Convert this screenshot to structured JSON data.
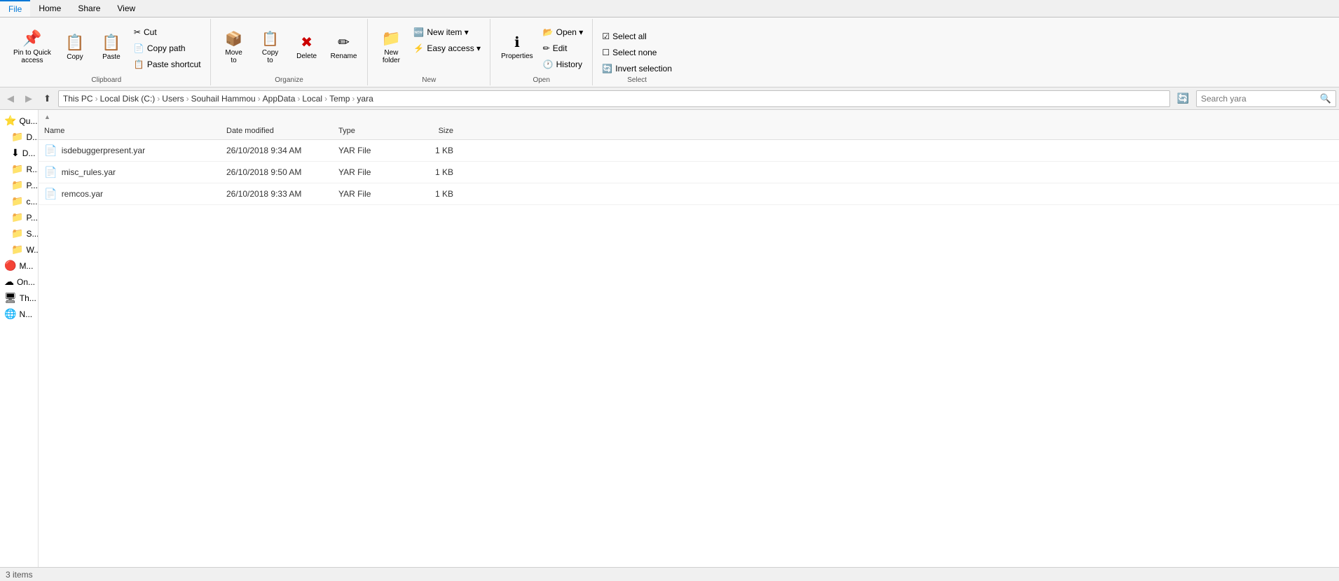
{
  "window": {
    "title": "yara"
  },
  "ribbon": {
    "tabs": [
      {
        "label": "File",
        "active": true
      },
      {
        "label": "Home",
        "active": false
      },
      {
        "label": "Share",
        "active": false
      },
      {
        "label": "View",
        "active": false
      }
    ],
    "clipboard_group": {
      "label": "Clipboard",
      "pin_to_quick": "Pin to Quick\naccess",
      "copy": "Copy",
      "paste": "Paste",
      "cut": "Cut",
      "copy_path": "Copy path",
      "paste_shortcut": "Paste shortcut"
    },
    "organize_group": {
      "label": "Organize",
      "move_to": "Move\nto",
      "copy_to": "Copy\nto",
      "delete": "Delete",
      "rename": "Rename"
    },
    "new_group": {
      "label": "New",
      "new_folder": "New\nfolder",
      "new_item": "New item ▾",
      "easy_access": "Easy access ▾"
    },
    "open_group": {
      "label": "Open",
      "properties": "Properties",
      "open": "Open ▾",
      "edit": "Edit",
      "history": "History"
    },
    "select_group": {
      "label": "Select",
      "select_all": "Select all",
      "select_none": "Select none",
      "invert_selection": "Invert selection"
    }
  },
  "nav": {
    "back": "◀",
    "forward": "▶",
    "up": "⬆",
    "breadcrumbs": [
      {
        "label": "This PC",
        "sep": true
      },
      {
        "label": "Local Disk (C:)",
        "sep": true
      },
      {
        "label": "Users",
        "sep": true
      },
      {
        "label": "Souhail Hammou",
        "sep": true
      },
      {
        "label": "AppData",
        "sep": true
      },
      {
        "label": "Local",
        "sep": true
      },
      {
        "label": "Temp",
        "sep": true
      },
      {
        "label": "yara",
        "sep": false
      }
    ],
    "search_placeholder": "Search yara"
  },
  "sidebar": {
    "items": [
      {
        "label": "Qu...",
        "icon": "⭐"
      },
      {
        "label": "D...",
        "icon": "📁"
      },
      {
        "label": "D...",
        "icon": "⬇"
      },
      {
        "label": "R...",
        "icon": "📁"
      },
      {
        "label": "P...",
        "icon": "📁"
      },
      {
        "label": "c...",
        "icon": "📁"
      },
      {
        "label": "P...",
        "icon": "📁"
      },
      {
        "label": "S...",
        "icon": "📁"
      },
      {
        "label": "W...",
        "icon": "📁"
      },
      {
        "label": "M...",
        "icon": "🔴"
      },
      {
        "label": "On...",
        "icon": "☁"
      },
      {
        "label": "Th...",
        "icon": "🖥"
      },
      {
        "label": "N...",
        "icon": "🌐"
      }
    ]
  },
  "file_list": {
    "columns": [
      {
        "label": "Name",
        "key": "name"
      },
      {
        "label": "Date modified",
        "key": "date"
      },
      {
        "label": "Type",
        "key": "type"
      },
      {
        "label": "Size",
        "key": "size"
      }
    ],
    "sort_column": "name",
    "sort_dir": "asc",
    "files": [
      {
        "name": "isdebuggerpresent.yar",
        "icon": "📄",
        "date": "26/10/2018 9:34 AM",
        "type": "YAR File",
        "size": "1 KB"
      },
      {
        "name": "misc_rules.yar",
        "icon": "📄",
        "date": "26/10/2018 9:50 AM",
        "type": "YAR File",
        "size": "1 KB"
      },
      {
        "name": "remcos.yar",
        "icon": "📄",
        "date": "26/10/2018 9:33 AM",
        "type": "YAR File",
        "size": "1 KB"
      }
    ]
  },
  "status_bar": {
    "text": "3 items"
  },
  "colors": {
    "accent": "#0078d7",
    "ribbon_bg": "#f8f8f8",
    "hover": "#e8f0fe"
  }
}
